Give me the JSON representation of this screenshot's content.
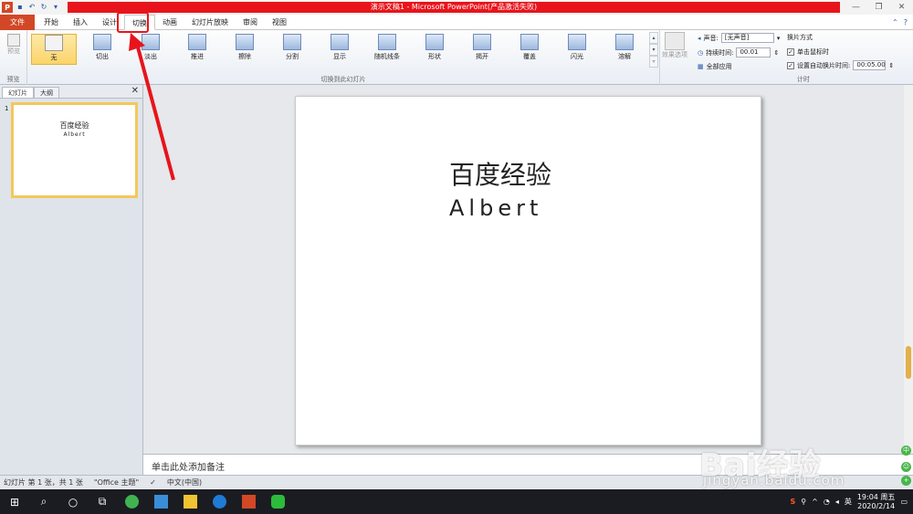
{
  "titlebar": {
    "title": "演示文稿1 - Microsoft PowerPoint(产品激活失败)",
    "logo": "P",
    "quick_access_icons": [
      "save-icon",
      "undo-icon",
      "redo-icon",
      "customize-icon"
    ]
  },
  "menu": {
    "file": "文件",
    "tabs": [
      "开始",
      "插入",
      "设计",
      "切换",
      "动画",
      "幻灯片放映",
      "审阅",
      "视图"
    ],
    "active_tab": "切换"
  },
  "ribbon": {
    "preview_label": "预览",
    "preview_group_label": "预览",
    "transitions": [
      "无",
      "切出",
      "淡出",
      "推进",
      "擦除",
      "分割",
      "显示",
      "随机线条",
      "形状",
      "揭开",
      "覆盖",
      "闪光",
      "溶解"
    ],
    "selected_transition": "无",
    "group_label": "切换到此幻灯片",
    "effect_label": "效果选项",
    "timing": {
      "sound_label": "声音:",
      "sound_value": "[无声音]",
      "duration_label": "持续时间:",
      "duration_value": "00.01",
      "apply_all_label": "全部应用",
      "advance_label": "换片方式",
      "on_click_label": "单击鼠标时",
      "after_label": "设置自动换片时间:",
      "after_value": "00:05.00",
      "group_label": "计时"
    }
  },
  "left_panel": {
    "tab_slides": "幻灯片",
    "tab_outline": "大纲",
    "slide_number": "1",
    "thumb_title": "百度经验",
    "thumb_subtitle": "Albert"
  },
  "slide": {
    "title": "百度经验",
    "subtitle": "Albert"
  },
  "notes": {
    "placeholder": "单击此处添加备注"
  },
  "statusbar": {
    "slide_info": "幻灯片 第 1 张，共 1 张",
    "theme": "\"Office 主题\"",
    "language": "中文(中国)"
  },
  "taskbar": {
    "time": "19:04 周五",
    "date": "2020/2/14",
    "ime": "英"
  },
  "watermark": {
    "brand": "Bai经验",
    "url": "jingyan.baidu.com"
  },
  "colors": {
    "title_bar_red": "#e8141b",
    "file_tab": "#d24726",
    "selected_transition": "#fbd46a"
  }
}
